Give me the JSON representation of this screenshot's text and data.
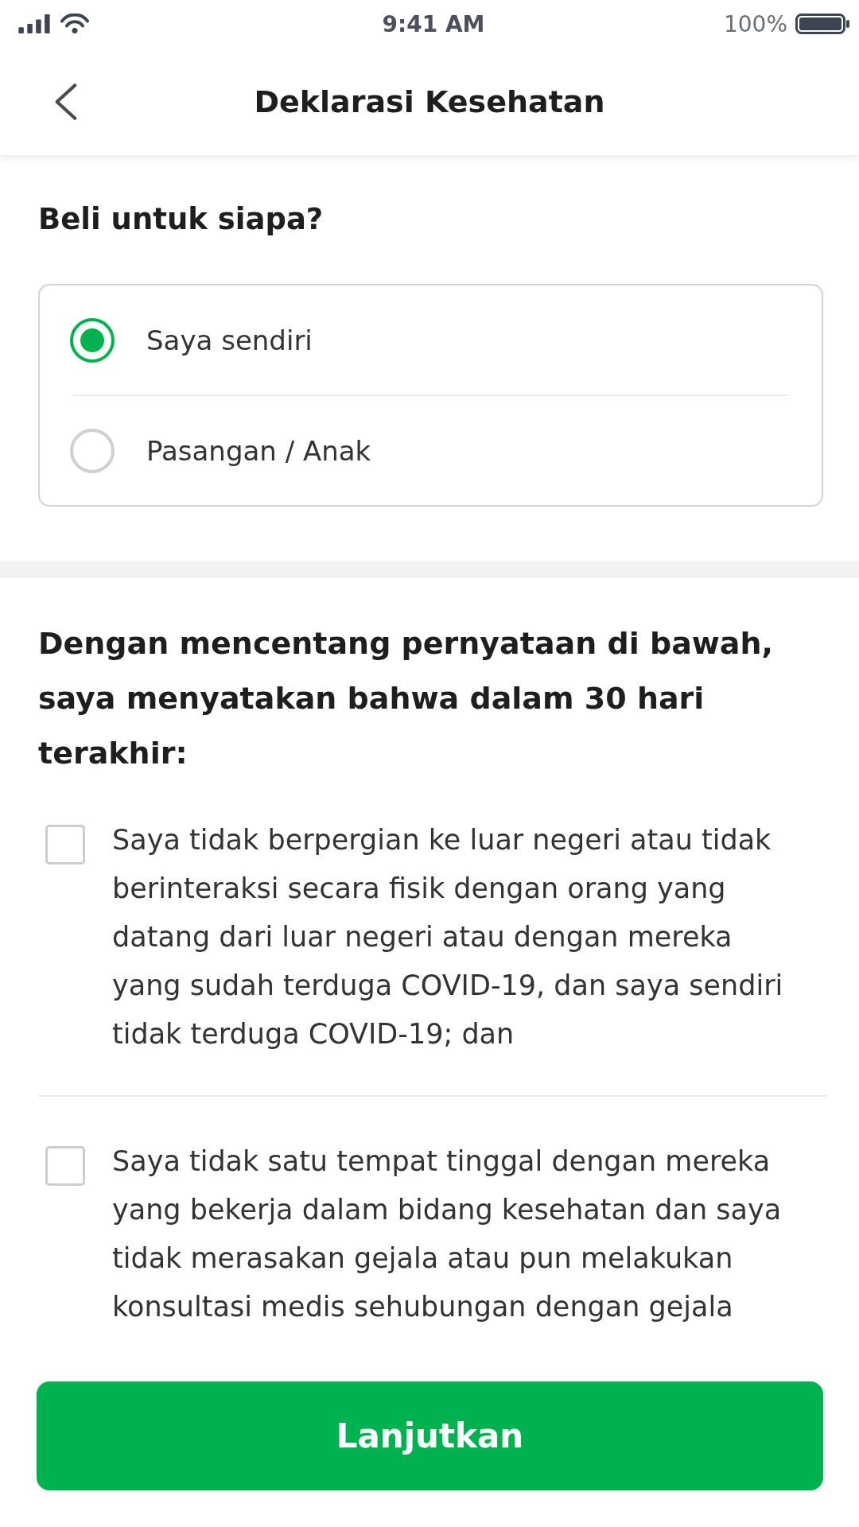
{
  "status_bar": {
    "time": "9:41 AM",
    "battery_percent": "100%"
  },
  "header": {
    "title": "Deklarasi Kesehatan"
  },
  "recipient": {
    "question": "Beli untuk siapa?",
    "options": [
      {
        "label": "Saya sendiri",
        "selected": true
      },
      {
        "label": "Pasangan / Anak",
        "selected": false
      }
    ]
  },
  "declaration": {
    "intro": "Dengan mencentang pernyataan di bawah, saya menyatakan bahwa dalam 30 hari terakhir:",
    "statements": [
      {
        "text": "Saya tidak berpergian ke luar negeri atau tidak berinteraksi secara fisik dengan orang yang datang dari luar negeri atau dengan mereka yang sudah terduga COVID-19, dan saya sendiri tidak terduga COVID-19; dan",
        "checked": false
      },
      {
        "text": "Saya tidak satu tempat tinggal dengan mereka yang bekerja dalam bidang kesehatan dan saya tidak merasakan gejala atau pun melakukan konsultasi medis sehubungan dengan gejala",
        "checked": false
      }
    ]
  },
  "continue_button": {
    "label": "Lanjutkan"
  }
}
